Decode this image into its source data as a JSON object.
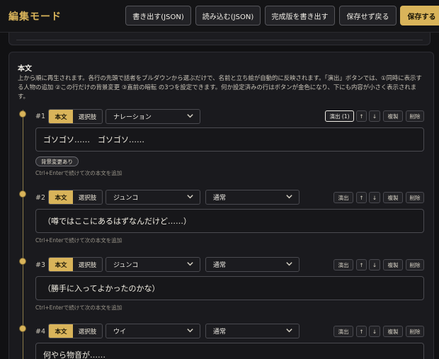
{
  "header": {
    "title": "編集モード",
    "buttons": {
      "export_json": "書き出す(JSON)",
      "import_json": "読み込む(JSON)",
      "export_final": "完成版を書き出す",
      "exit_without_save": "保存せず戻る",
      "save": "保存する"
    }
  },
  "section": {
    "title": "本文",
    "description": "上から順に再生されます。各行の先頭で話者をプルダウンから選ぶだけで、名前と立ち絵が自動的に反映されます。「演出」ボタンでは、①同時に表示する人物の追加 ②この行だけの背景変更 ③直前の暗転 の3つを設定できます。何か設定済みの行はボタンが金色になり、下にも内容が小さく表示されます。"
  },
  "row_controls": {
    "mode_body": "本文",
    "mode_choice": "選択肢",
    "up": "↑",
    "down": "↓",
    "duplicate": "複製",
    "delete": "削除",
    "hint": "Ctrl+Enterで続けて次の本文を追加"
  },
  "rows": [
    {
      "num": "#1",
      "speaker": "ナレーション",
      "expression": "",
      "effects_label": "演出 (1)",
      "text": "ゴソゴソ……　ゴソゴソ……",
      "badge": "背景変更あり"
    },
    {
      "num": "#2",
      "speaker": "ジュンコ",
      "expression": "通常",
      "effects_label": "演出",
      "text": "（噂ではここにあるはずなんだけど……）"
    },
    {
      "num": "#3",
      "speaker": "ジュンコ",
      "expression": "通常",
      "effects_label": "演出",
      "text": "（勝手に入ってよかったのかな）"
    },
    {
      "num": "#4",
      "speaker": "ウイ",
      "expression": "通常",
      "effects_label": "演出",
      "text": "何やら物音が……"
    }
  ],
  "colors": {
    "accent": "#d9b45a",
    "background": "#111113",
    "panel": "#1a1a1e"
  }
}
